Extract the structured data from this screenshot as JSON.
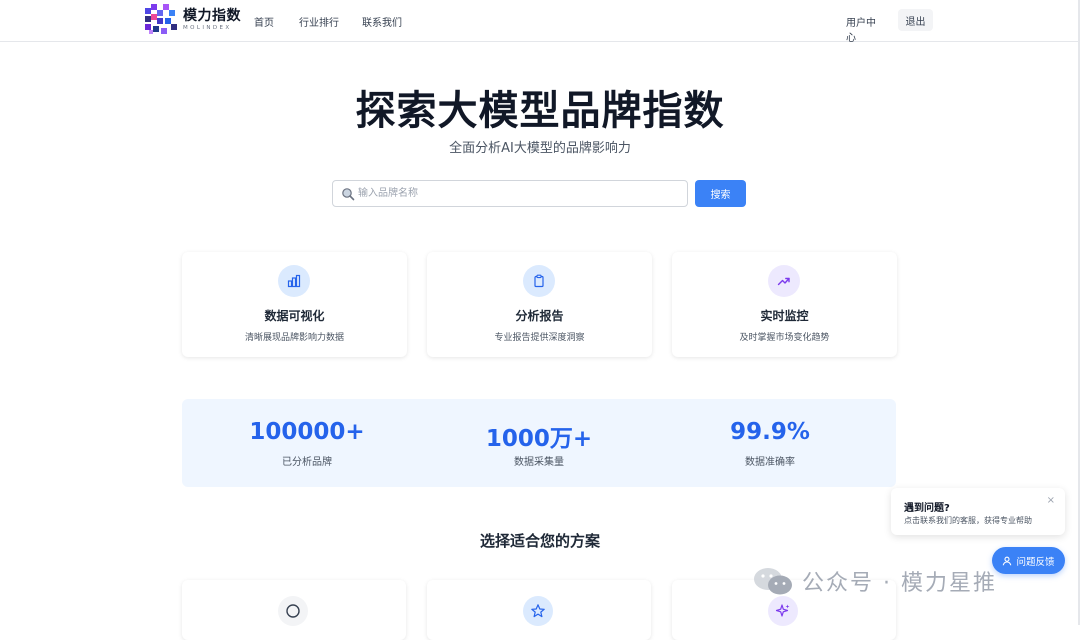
{
  "nav": {
    "logo_cn": "模力指数",
    "logo_en": "MOLINDEX",
    "links": [
      "首页",
      "行业排行",
      "联系我们"
    ],
    "user_center": "用户中心",
    "logout": "退出"
  },
  "hero": {
    "title": "探索大模型品牌指数",
    "subtitle": "全面分析AI大模型的品牌影响力"
  },
  "search": {
    "placeholder": "输入品牌名称",
    "button": "搜索",
    "icon": "magnifier-icon"
  },
  "features": [
    {
      "title": "数据可视化",
      "desc": "清晰展现品牌影响力数据",
      "icon": "bar-chart-icon",
      "color": "#2563eb",
      "bg": "#dbeafe"
    },
    {
      "title": "分析报告",
      "desc": "专业报告提供深度洞察",
      "icon": "clipboard-icon",
      "color": "#2563eb",
      "bg": "#dbeafe"
    },
    {
      "title": "实时监控",
      "desc": "及时掌握市场变化趋势",
      "icon": "trend-up-icon",
      "color": "#7c3aed",
      "bg": "#ede9fe"
    }
  ],
  "stats": [
    {
      "value": "100000+",
      "label": "已分析品牌"
    },
    {
      "value": "1000万+",
      "label": "数据采集量"
    },
    {
      "value": "99.9%",
      "label": "数据准确率"
    }
  ],
  "plans": {
    "title": "选择适合您的方案",
    "cards": [
      {
        "icon": "circle-icon",
        "bg": "#f3f4f6",
        "color": "#374151"
      },
      {
        "icon": "star-icon",
        "bg": "#dbeafe",
        "color": "#2563eb"
      },
      {
        "icon": "sparkle-icon",
        "bg": "#ede9fe",
        "color": "#7c3aed"
      }
    ]
  },
  "feedback": {
    "popup_title": "遇到问题?",
    "popup_text": "点击联系我们的客服，获得专业帮助",
    "close": "×",
    "button": "问题反馈"
  },
  "watermark": {
    "text": "公众号 · 模力星推"
  },
  "colors": {
    "accent": "#3b82f6",
    "stat_number": "#2563eb",
    "stats_bg": "#eff6ff"
  }
}
